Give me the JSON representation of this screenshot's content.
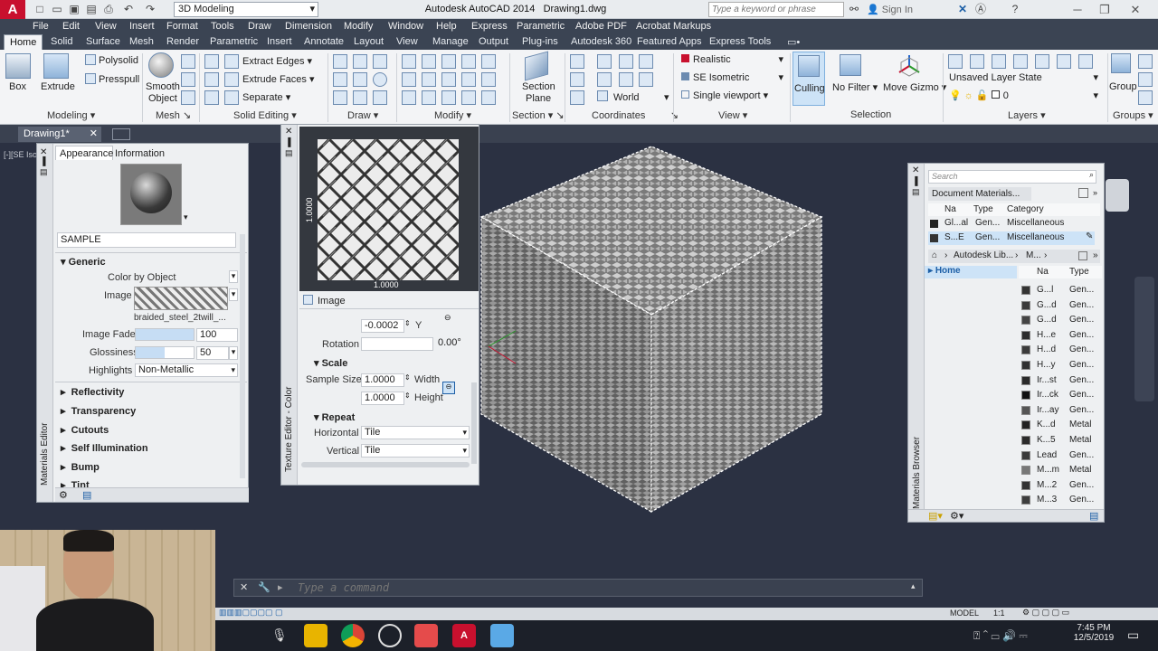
{
  "title_bar": {
    "workspace": "3D Modeling",
    "app_title": "Autodesk AutoCAD 2014",
    "file_title": "Drawing1.dwg",
    "search_placeholder": "Type a keyword or phrase",
    "sign_in": "Sign In"
  },
  "menu": [
    "File",
    "Edit",
    "View",
    "Insert",
    "Format",
    "Tools",
    "Draw",
    "Dimension",
    "Modify",
    "Window",
    "Help",
    "Express",
    "Parametric",
    "Adobe PDF",
    "Acrobat Markups"
  ],
  "ribbon_tabs": [
    "Home",
    "Solid",
    "Surface",
    "Mesh",
    "Render",
    "Parametric",
    "Insert",
    "Annotate",
    "Layout",
    "View",
    "Manage",
    "Output",
    "Plug-ins",
    "Autodesk 360",
    "Featured Apps",
    "Express Tools"
  ],
  "ribbon": {
    "box": "Box",
    "extrude": "Extrude",
    "polysolid": "Polysolid",
    "presspull": "Presspull",
    "smooth_object_1": "Smooth",
    "smooth_object_2": "Object",
    "extract_edges": "Extract Edges",
    "extrude_faces": "Extrude Faces",
    "separate": "Separate",
    "section_plane_1": "Section",
    "section_plane_2": "Plane",
    "visual_style": "Realistic",
    "view_preset": "SE Isometric",
    "ucs": "World",
    "viewport": "Single viewport",
    "culling": "Culling",
    "no_filter": "No Filter",
    "move_gizmo": "Move Gizmo",
    "layer_state": "Unsaved Layer State",
    "layer_current": "0",
    "group": "Group",
    "panels": [
      "Modeling",
      "Mesh",
      "Solid Editing",
      "Draw",
      "Modify",
      "Section",
      "Coordinates",
      "View",
      "Selection",
      "Layers",
      "Groups"
    ]
  },
  "file_tab": "Drawing1*",
  "viewport_label": "[-][SE Iso",
  "materials_editor": {
    "tabs": [
      "Appearance",
      "Information"
    ],
    "name": "SAMPLE",
    "generic": "Generic",
    "color_label": "Color",
    "color_value": "by Object",
    "image_label": "Image",
    "image_name": "braided_steel_2twill_...",
    "image_fade_label": "Image Fade",
    "image_fade": "100",
    "image_fade_level": 1.0,
    "glossiness_label": "Glossiness",
    "glossiness": "50",
    "glossiness_level": 0.5,
    "highlights_label": "Highlights",
    "highlights": "Non-Metallic",
    "sections": [
      "Reflectivity",
      "Transparency",
      "Cutouts",
      "Self Illumination",
      "Bump",
      "Tint"
    ],
    "side_title": "Materials Editor"
  },
  "texture_editor": {
    "side_title": "Texture Editor - Color",
    "dim_x": "1.0000",
    "dim_y": "1.0000",
    "image_label": "Image",
    "y_value": "-0.0002",
    "y_label": "Y",
    "rotation_label": "Rotation",
    "rotation": "0.00°",
    "scale_label": "Scale",
    "sample_size_label": "Sample Size",
    "width_value": "1.0000",
    "width_label": "Width",
    "height_value": "1.0000",
    "height_label": "Height",
    "repeat_label": "Repeat",
    "horizontal_label": "Horizontal",
    "horizontal": "Tile",
    "vertical_label": "Vertical",
    "vertical": "Tile"
  },
  "materials_browser": {
    "side_title": "Materials Browser",
    "search_placeholder": "Search",
    "doc_materials": "Document Materials...",
    "doc_headers": [
      "Na",
      "Type",
      "Category"
    ],
    "doc_rows": [
      {
        "name": "Gl...al",
        "type": "Gen...",
        "category": "Miscellaneous"
      },
      {
        "name": "S...E",
        "type": "Gen...",
        "category": "Miscellaneous"
      }
    ],
    "library": "Autodesk Lib...",
    "library_sub": "M...",
    "tree_home": "Home",
    "lib_headers": [
      "Na",
      "Type"
    ],
    "lib_rows": [
      {
        "name": "G...l",
        "type": "Gen...",
        "swatch": "#333333"
      },
      {
        "name": "G...d",
        "type": "Gen...",
        "swatch": "#3a3a3a"
      },
      {
        "name": "G...d",
        "type": "Gen...",
        "swatch": "#444444"
      },
      {
        "name": "H...e",
        "type": "Gen...",
        "swatch": "#2d2d2d"
      },
      {
        "name": "H...d",
        "type": "Gen...",
        "swatch": "#3b3b3b"
      },
      {
        "name": "H...y",
        "type": "Gen...",
        "swatch": "#303030"
      },
      {
        "name": "Ir...st",
        "type": "Gen...",
        "swatch": "#2a2a2a"
      },
      {
        "name": "Ir...ck",
        "type": "Gen...",
        "swatch": "#111111"
      },
      {
        "name": "Ir...ay",
        "type": "Gen...",
        "swatch": "#555555"
      },
      {
        "name": "K...d",
        "type": "Metal",
        "swatch": "#222222"
      },
      {
        "name": "K...5",
        "type": "Metal",
        "swatch": "#2b2b2b"
      },
      {
        "name": "Lead",
        "type": "Gen...",
        "swatch": "#3a3a3a"
      },
      {
        "name": "M...m",
        "type": "Metal",
        "swatch": "#777777"
      },
      {
        "name": "M...2",
        "type": "Gen...",
        "swatch": "#333333"
      },
      {
        "name": "M...3",
        "type": "Gen...",
        "swatch": "#3d3d3d"
      }
    ]
  },
  "command_line": {
    "placeholder": "Type a command"
  },
  "status": {
    "model": "MODEL",
    "scale": "1:1"
  },
  "taskbar": {
    "time": "7:45 PM",
    "date": "12/5/2019"
  },
  "colors": {
    "accent": "#c8102e",
    "ribbon_bg": "#f3f4f6",
    "dark_chrome": "#3b4453",
    "viewport": "#2b3142"
  }
}
